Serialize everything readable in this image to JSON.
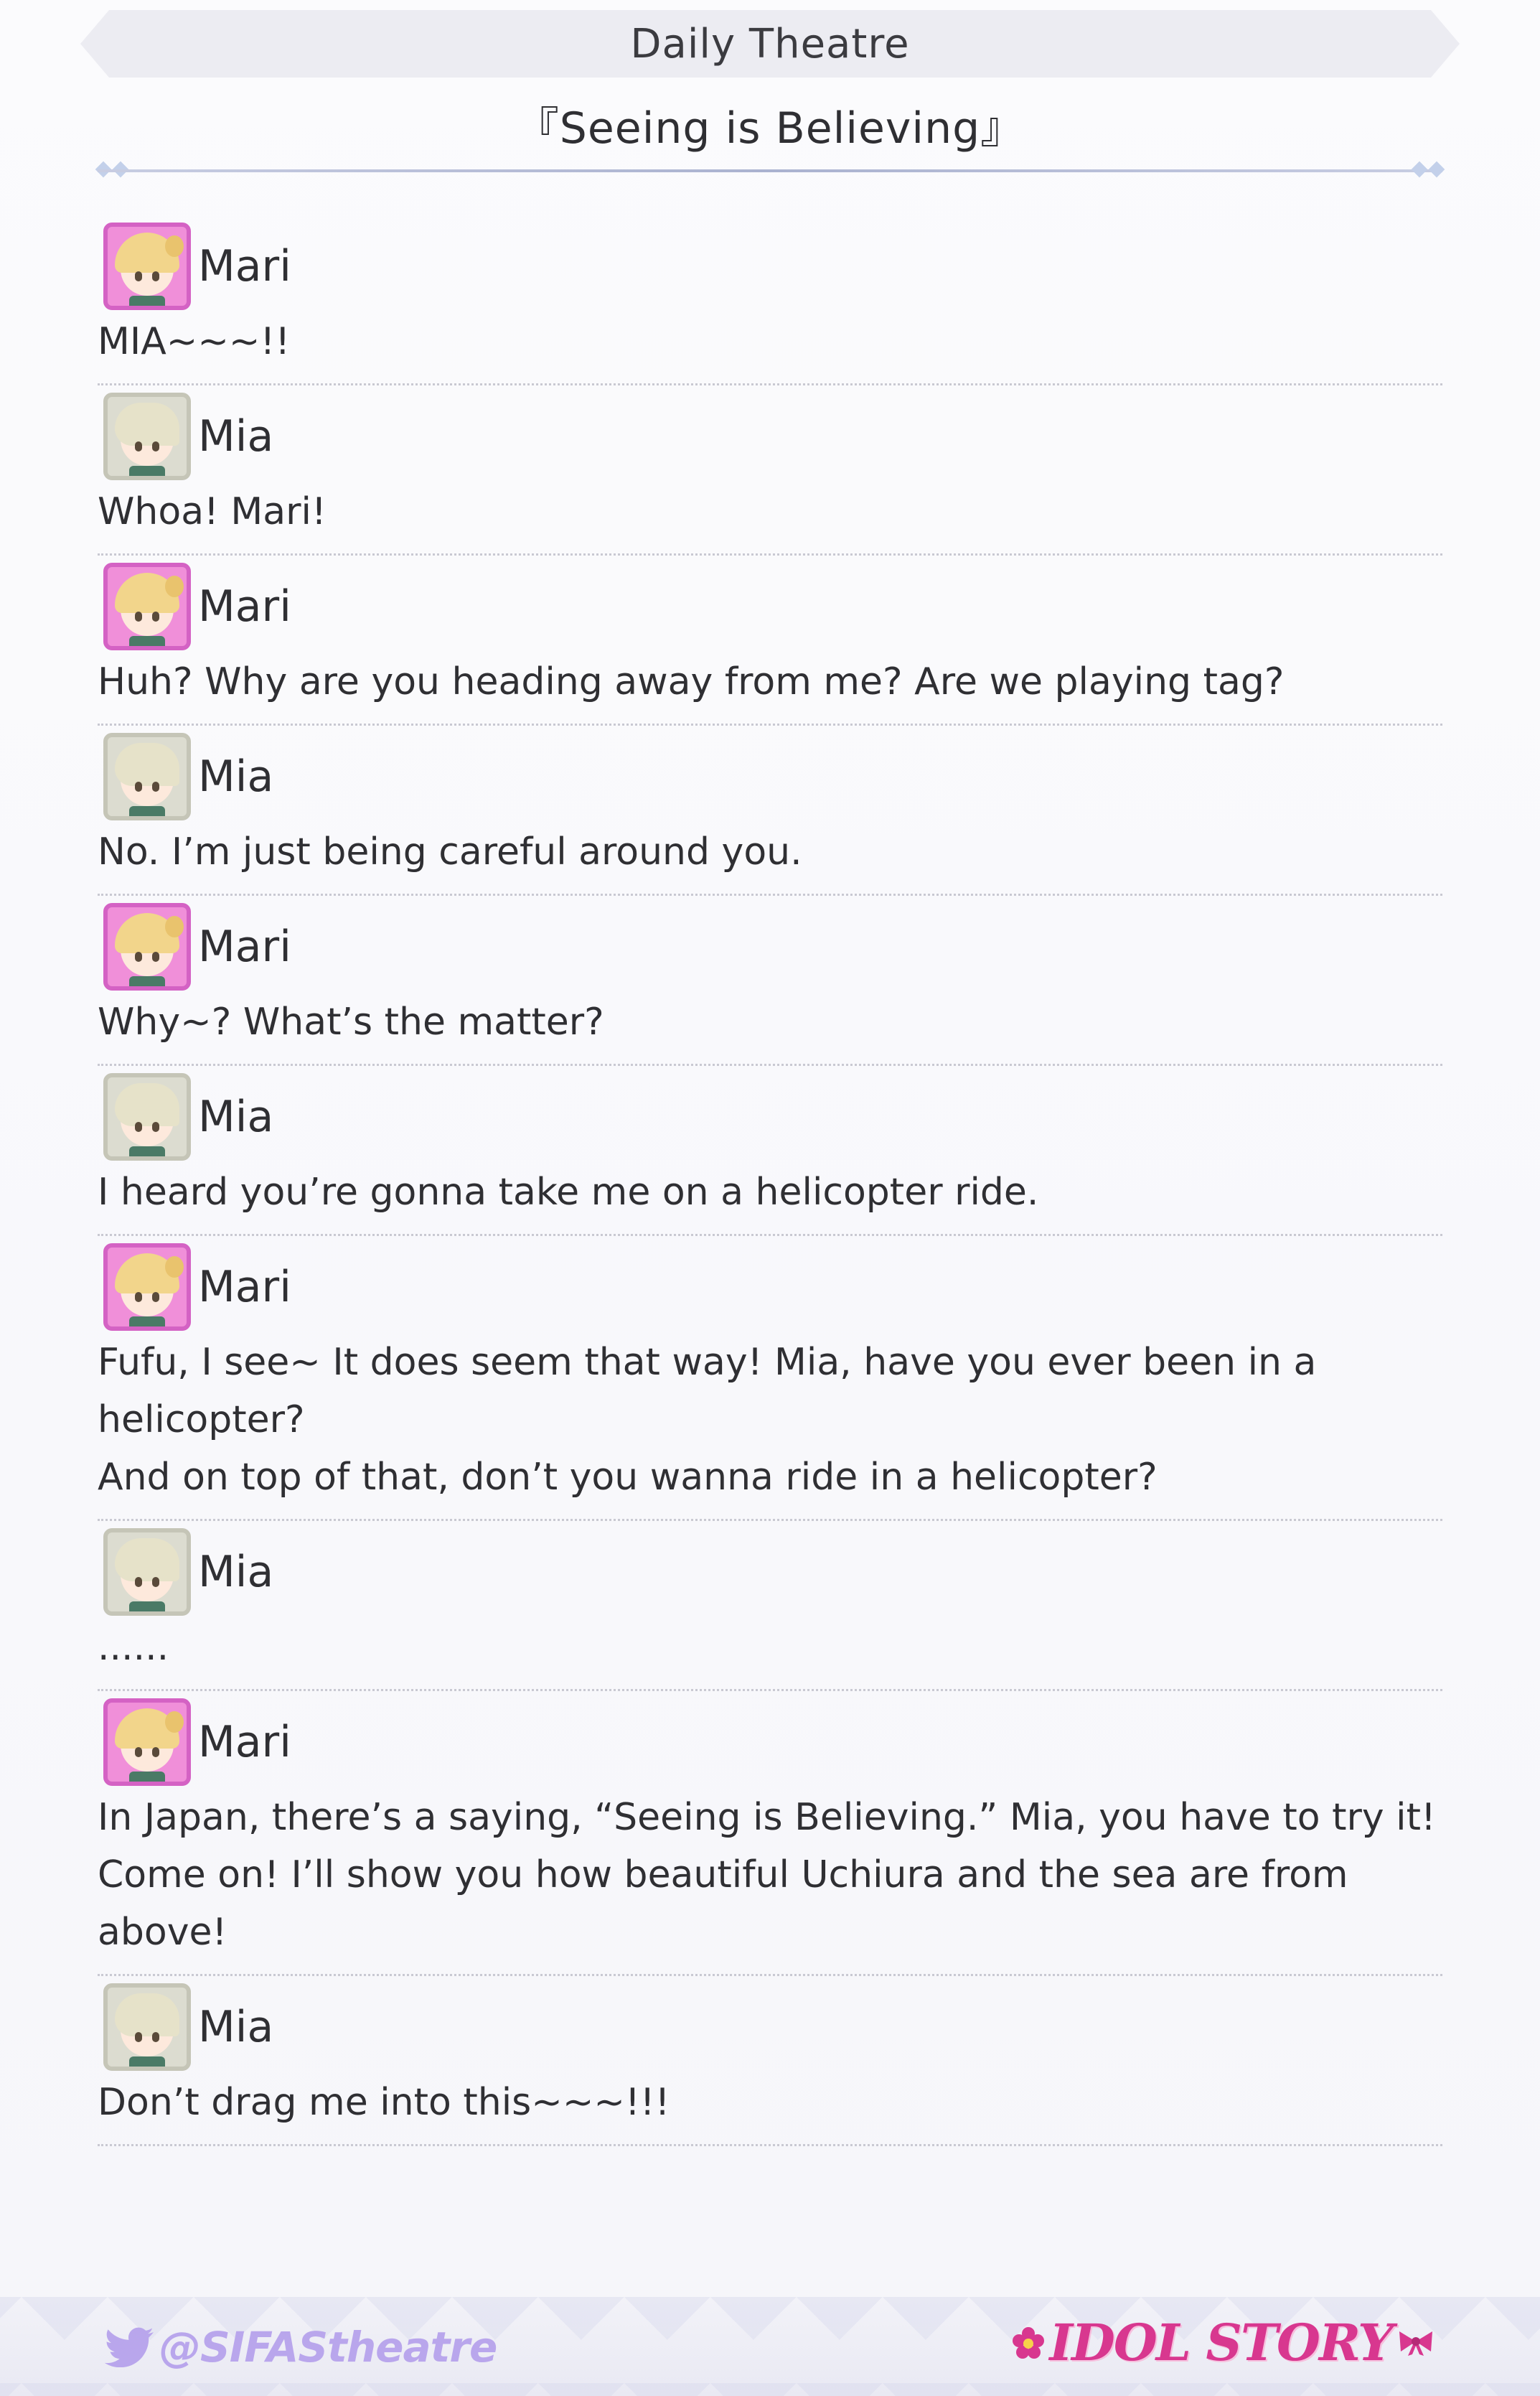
{
  "header": {
    "title": "Daily Theatre",
    "story_title": "『Seeing is Believing』"
  },
  "dialogue": [
    {
      "speaker": "Mari",
      "avatar": "mari-avatar",
      "text": "MIA~~~!!"
    },
    {
      "speaker": "Mia",
      "avatar": "mia-avatar",
      "text": "Whoa! Mari!"
    },
    {
      "speaker": "Mari",
      "avatar": "mari-avatar",
      "text": "Huh? Why are you heading away from me? Are we playing tag?"
    },
    {
      "speaker": "Mia",
      "avatar": "mia-avatar",
      "text": "No. I’m just being careful around you."
    },
    {
      "speaker": "Mari",
      "avatar": "mari-avatar",
      "text": "Why~? What’s the matter?"
    },
    {
      "speaker": "Mia",
      "avatar": "mia-avatar",
      "text": "I heard you’re gonna take me on a helicopter ride."
    },
    {
      "speaker": "Mari",
      "avatar": "mari-avatar",
      "text": "Fufu, I see~ It does seem that way! Mia, have you ever been in a helicopter?\nAnd on top of that, don’t you wanna ride in a helicopter?"
    },
    {
      "speaker": "Mia",
      "avatar": "mia-avatar",
      "text": "......"
    },
    {
      "speaker": "Mari",
      "avatar": "mari-avatar",
      "text": "In Japan, there’s a saying, “Seeing is Believing.” Mia, you have to try it!\nCome on! I’ll show you how beautiful Uchiura and the sea are from above!"
    },
    {
      "speaker": "Mia",
      "avatar": "mia-avatar",
      "text": "Don’t drag me into this~~~!!!"
    }
  ],
  "footer": {
    "twitter_handle": "@SIFAStheatre",
    "brand": "IDOL STORY",
    "colors": {
      "twitter": "#b9a6ec",
      "brand": "#d8378f"
    }
  }
}
